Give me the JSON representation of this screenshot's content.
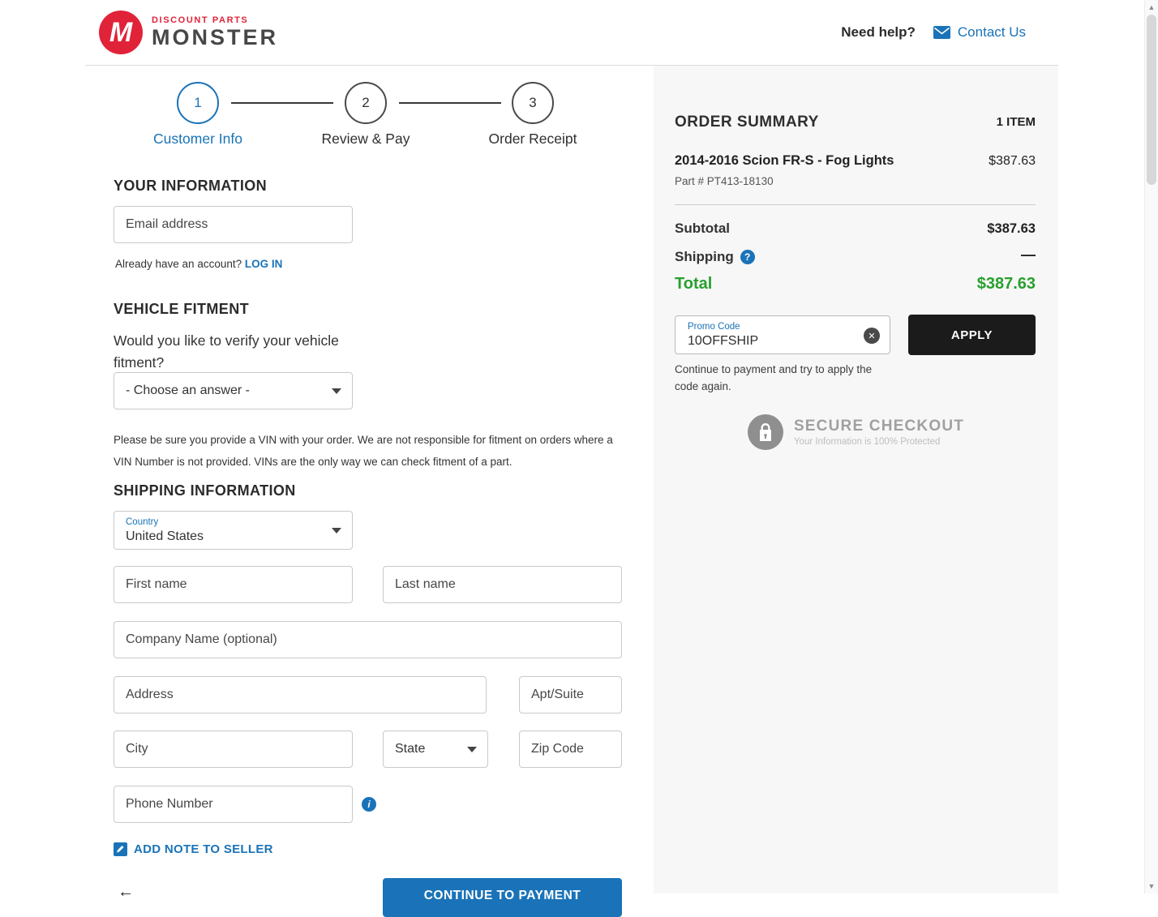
{
  "header": {
    "brand": {
      "monogram": "M",
      "tagline": "DISCOUNT PARTS",
      "name": "MONSTER"
    },
    "need_help": "Need help?",
    "contact_us": "Contact Us"
  },
  "stepper": {
    "steps": [
      {
        "number": "1",
        "label": "Customer Info"
      },
      {
        "number": "2",
        "label": "Review & Pay"
      },
      {
        "number": "3",
        "label": "Order Receipt"
      }
    ]
  },
  "your_information": {
    "title": "YOUR INFORMATION",
    "email_placeholder": "Email address",
    "account_prompt": "Already have an account?",
    "login_label": "LOG IN"
  },
  "vehicle_fitment": {
    "title": "VEHICLE FITMENT",
    "question": "Would you like to verify your vehicle fitment?",
    "answer_value": "- Choose an answer -",
    "vin_note": "Please be sure you provide a VIN with your order. We are not responsible for fitment on orders where a VIN Number is not provided. VINs are the only way we can check fitment of a part."
  },
  "shipping_info": {
    "title": "SHIPPING INFORMATION",
    "country_label": "Country",
    "country_value": "United States",
    "first_name_placeholder": "First name",
    "last_name_placeholder": "Last name",
    "company_placeholder": "Company Name (optional)",
    "address_placeholder": "Address",
    "apt_placeholder": "Apt/Suite",
    "city_placeholder": "City",
    "state_value": "State",
    "zip_placeholder": "Zip Code",
    "phone_placeholder": "Phone Number",
    "add_note_label": "ADD NOTE TO SELLER",
    "continue_label": "CONTINUE TO PAYMENT"
  },
  "order_summary": {
    "title": "ORDER SUMMARY",
    "item_count": "1 ITEM",
    "item_name": "2014-2016 Scion FR-S - Fog Lights",
    "item_price": "$387.63",
    "item_part": "Part # PT413-18130",
    "subtotal_label": "Subtotal",
    "subtotal_value": "$387.63",
    "shipping_label": "Shipping",
    "shipping_value": "—",
    "total_label": "Total",
    "total_value": "$387.63",
    "promo_label": "Promo Code",
    "promo_value": "10OFFSHIP",
    "apply_label": "APPLY",
    "promo_note": "Continue to payment and try to apply the code again.",
    "secure_title": "SECURE CHECKOUT",
    "secure_subtitle": "Your Information is 100% Protected"
  },
  "icons": {
    "info": "i",
    "help": "?",
    "clear": "✕",
    "scroll_up": "▲",
    "scroll_down": "▼",
    "back": "←"
  },
  "colors": {
    "accent_blue": "#1a73b8",
    "brand_red": "#e02339",
    "total_green": "#28a02e",
    "apply_black": "#1b1b1b"
  }
}
